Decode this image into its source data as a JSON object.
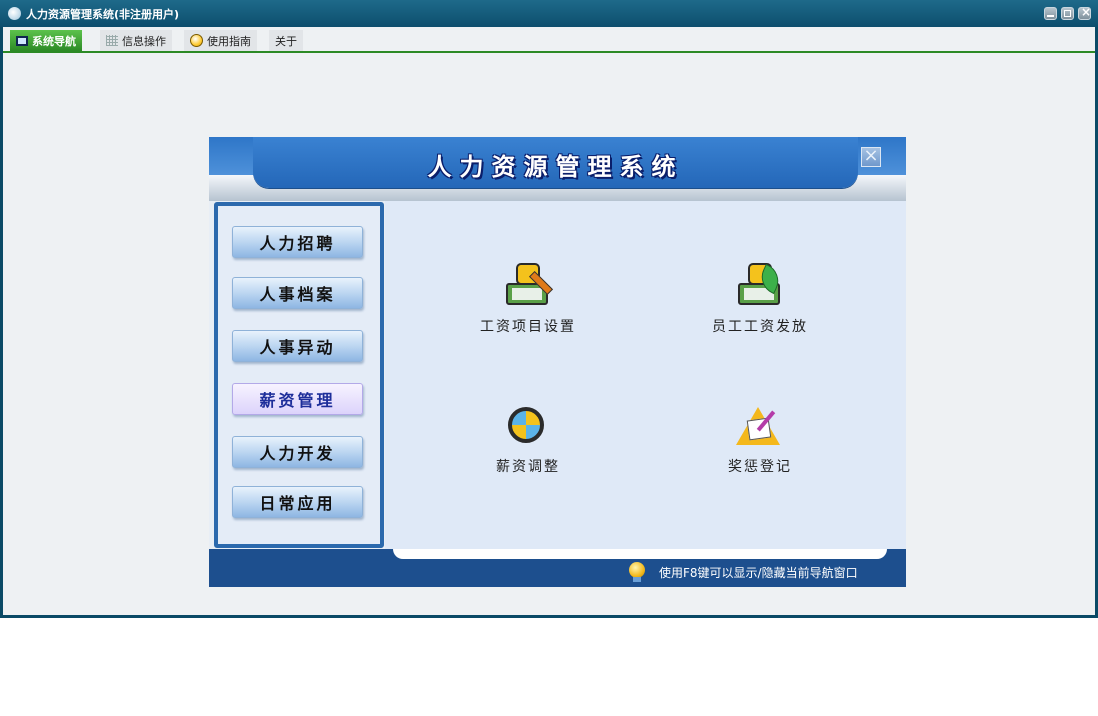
{
  "window": {
    "title": "人力资源管理系统(非注册用户)"
  },
  "tabs": [
    {
      "label": "系统导航",
      "icon": "monitor-icon",
      "active": true
    },
    {
      "label": "信息操作",
      "icon": "grid-icon",
      "active": false
    },
    {
      "label": "使用指南",
      "icon": "guide-icon",
      "active": false
    },
    {
      "label": "关于",
      "icon": "",
      "active": false
    }
  ],
  "panel": {
    "title": "人力资源管理系统",
    "close_icon": "close-icon"
  },
  "sidebar": {
    "items": [
      {
        "label": "人力招聘",
        "selected": false
      },
      {
        "label": "人事档案",
        "selected": false
      },
      {
        "label": "人事异动",
        "selected": false
      },
      {
        "label": "薪资管理",
        "selected": true
      },
      {
        "label": "人力开发",
        "selected": false
      },
      {
        "label": "日常应用",
        "selected": false
      }
    ]
  },
  "functions": [
    {
      "label": "工资项目设置",
      "icon": "salary-settings-icon"
    },
    {
      "label": "员工工资发放",
      "icon": "salary-payment-icon"
    },
    {
      "label": "薪资调整",
      "icon": "salary-adjust-icon"
    },
    {
      "label": "奖惩登记",
      "icon": "reward-record-icon"
    }
  ],
  "footer": {
    "hint": "使用F8键可以显示/隐藏当前导航窗口",
    "hint_icon": "lightbulb-icon"
  },
  "colors": {
    "title_bar": "#0d4e6d",
    "tab_active": "#2c8a25",
    "panel_header": "#2e76c8",
    "footer": "#1d4f8e",
    "selected_item": "#dcd3fb"
  }
}
